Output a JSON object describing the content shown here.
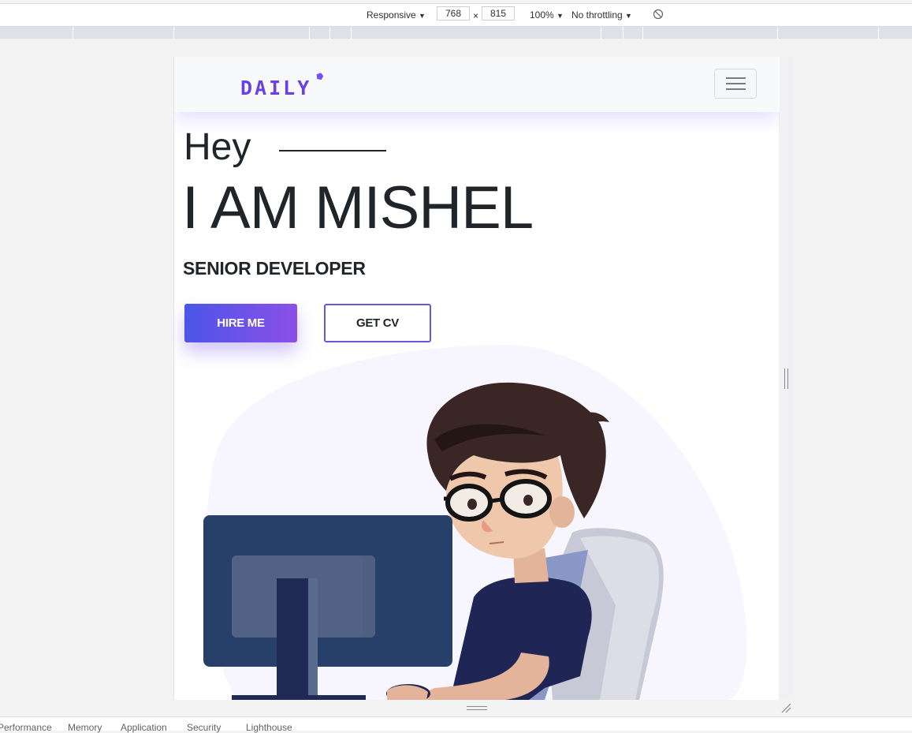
{
  "devtools": {
    "device_label": "Responsive",
    "width_value": "768",
    "times": "×",
    "height_value": "815",
    "zoom_label": "100%",
    "throttle_label": "No throttling",
    "dropdown_glyph": "▼",
    "drawer_tabs": [
      "Performance",
      "Memory",
      "Application",
      "Security",
      "Lighthouse"
    ]
  },
  "site": {
    "logo_text": "DAILY",
    "greeting": "Hey",
    "name": "I AM MISHEL",
    "role": "SENIOR DEVELOPER",
    "hire_button": "HIRE ME",
    "cv_button": "GET CV"
  },
  "colors": {
    "brand_purple": "#6a3fe6",
    "button_gradient_start": "#4b56e8",
    "button_gradient_end": "#8c4fe8",
    "text_dark": "#212529"
  }
}
